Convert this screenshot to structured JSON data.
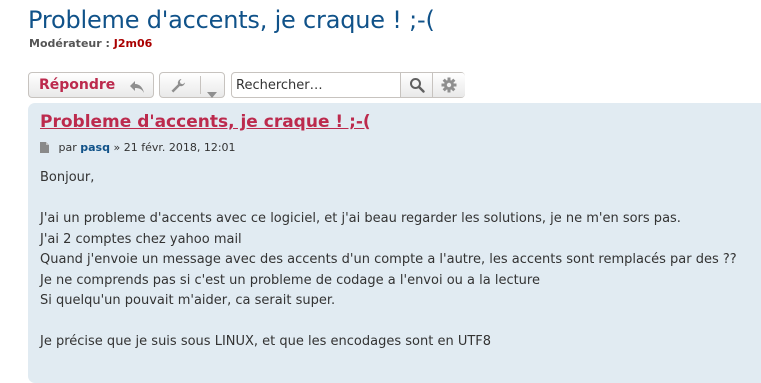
{
  "topic": {
    "title": "Probleme d'accents, je craque ! ;-(",
    "moderator_label": "Modérateur :",
    "moderator_name": "J2m06"
  },
  "action_bar": {
    "reply_label": "Répondre",
    "search_placeholder": "Rechercher…",
    "icons": {
      "reply": "reply-arrow-icon",
      "tools": "wrench-icon",
      "dropdown": "caret-down-icon",
      "search": "search-icon",
      "advanced_search": "gear-icon"
    }
  },
  "post": {
    "title": "Probleme d'accents, je craque ! ;-(",
    "meta_prefix": "par",
    "author": "pasq",
    "meta_separator": "»",
    "date": "21 févr. 2018, 12:01",
    "lines": [
      "Bonjour,",
      "J'ai un probleme d'accents avec ce logiciel, et j'ai beau regarder les solutions, je ne m'en sors pas.",
      "J'ai 2 comptes chez yahoo mail",
      "Quand j'envoie un message avec des accents d'un compte a l'autre, les accents sont remplacés par des ??",
      "Je ne comprends pas si c'est un probleme de codage a l'envoi ou a la lecture",
      "Si quelqu'un pouvait m'aider, ca serait super.",
      "Je précise que je suis sous LINUX, et que les encodages sont en UTF8"
    ]
  },
  "colors": {
    "title_blue": "#105289",
    "accent_red": "#bc2a4d",
    "post_bg": "#e1ebf2",
    "moderator_red": "#aa0000"
  }
}
